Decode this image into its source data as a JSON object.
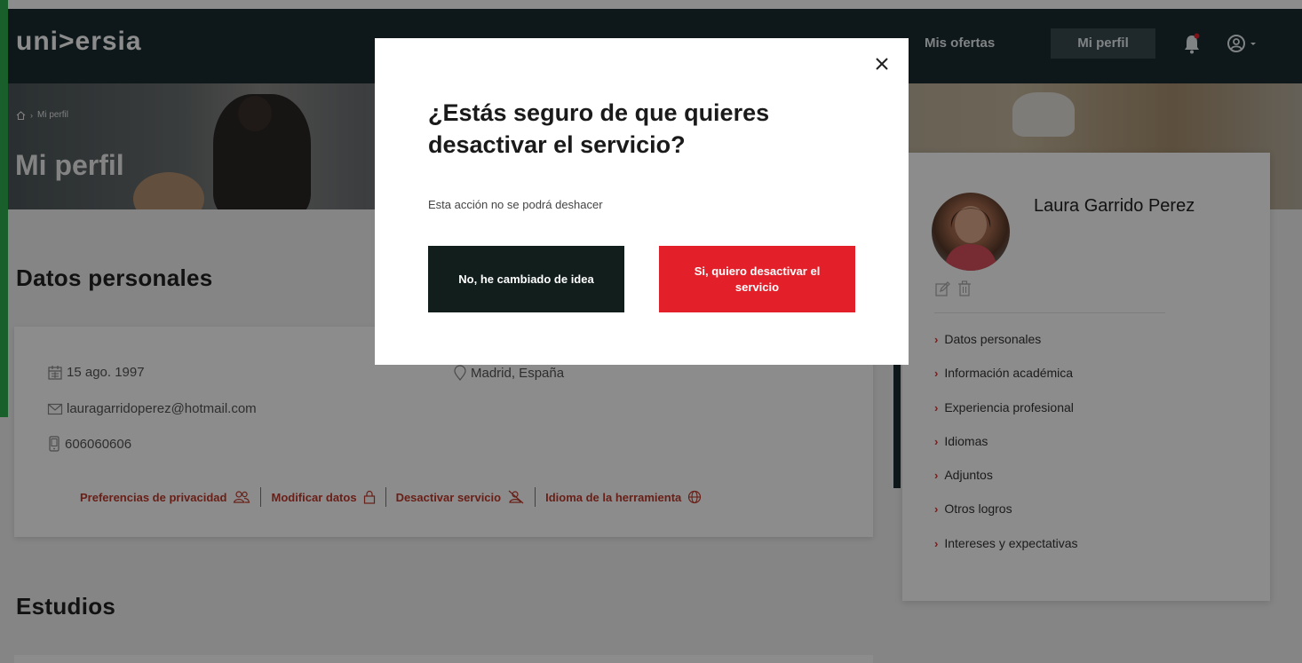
{
  "nav": {
    "logo": "uni>ersia",
    "links": [
      "Mis ofertas",
      "Mi perfil"
    ],
    "icons": [
      "bell-icon",
      "user-circle-icon",
      "caret-down-icon"
    ]
  },
  "hero": {
    "breadcrumb": [
      "Mi perfil"
    ],
    "title": "Mi perfil"
  },
  "personal": {
    "heading": "Datos personales",
    "birthdate": "15 ago. 1997",
    "location": "Madrid, España",
    "email": "lauragarridoperez@hotmail.com",
    "phone": "606060606",
    "actions": [
      "Preferencias de privacidad",
      "Modificar datos",
      "Desactivar servicio",
      "Idioma de la herramienta"
    ]
  },
  "studies": {
    "heading": "Estudios"
  },
  "sidebar": {
    "name": "Laura Garrido Perez",
    "items": [
      "Datos personales",
      "Información académica",
      "Experiencia profesional",
      "Idiomas",
      "Adjuntos",
      "Otros logros",
      "Intereses y expectativas"
    ]
  },
  "modal": {
    "title": "¿Estás seguro de que quieres desactivar el servicio?",
    "subtitle": "Esta acción no se podrá deshacer",
    "cancel_label": "No, he cambiado de idea",
    "confirm_label": "Si, quiero desactivar el servicio"
  },
  "colors": {
    "nav_bg": "#1a2a2f",
    "accent_red": "#e3202a",
    "link_red": "#c0392b",
    "dark_button": "#111e1c",
    "green_bar": "#2eae4f"
  }
}
